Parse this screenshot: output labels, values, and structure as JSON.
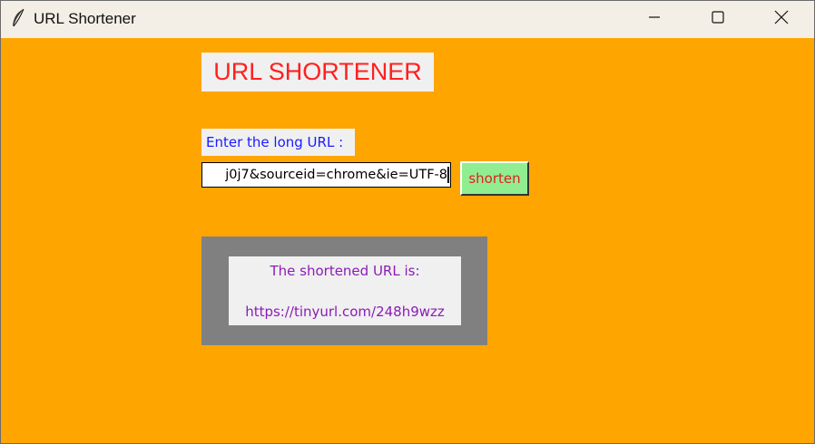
{
  "window": {
    "title": "URL Shortener",
    "app_icon": "feather-icon",
    "controls": {
      "minimize_icon": "minimize-icon",
      "maximize_icon": "maximize-icon",
      "close_icon": "close-icon"
    }
  },
  "colors": {
    "background": "#ffa500",
    "heading_text": "#ff2020",
    "label_text": "#1a1aff",
    "button_bg": "#90ee90",
    "button_text": "#e02020",
    "result_frame": "#808080",
    "result_text": "#8a1cb8"
  },
  "main": {
    "heading": "URL SHORTENER",
    "prompt_label": "Enter the long URL :",
    "url_input_visible_value": "j0j7&sourceid=chrome&ie=UTF-8",
    "shorten_button_label": "shorten",
    "result": {
      "title": "The shortened URL is:",
      "url": "https://tinyurl.com/248h9wzz"
    }
  }
}
